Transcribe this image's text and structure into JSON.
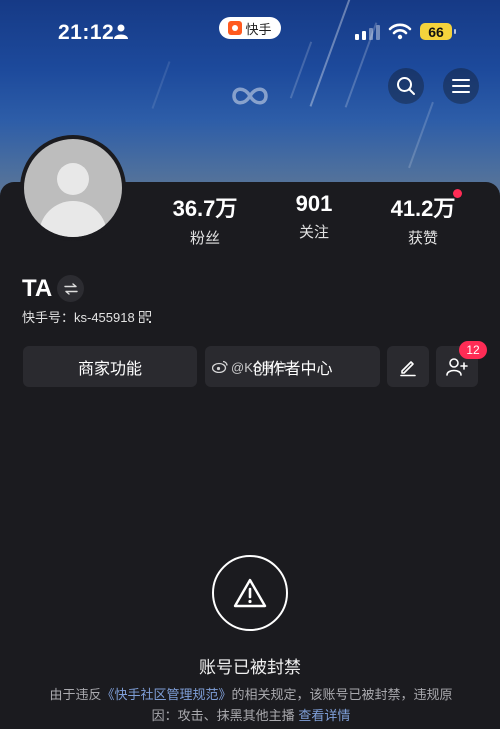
{
  "status_bar": {
    "time": "21:12",
    "app_name": "快手",
    "battery": "66"
  },
  "profile": {
    "stats": [
      {
        "value": "36.7万",
        "label": "粉丝"
      },
      {
        "value": "901",
        "label": "关注"
      },
      {
        "value": "41.2万",
        "label": "获赞"
      }
    ],
    "name": "TA",
    "account_label": "快手号：ks-455918"
  },
  "actions": {
    "merchant": "商家功能",
    "creator": "创作者中心",
    "friend_badge": "12"
  },
  "watermark": {
    "text": "@KS用户"
  },
  "banned": {
    "title": "账号已被封禁",
    "desc_prefix": "由于违反",
    "desc_rule": "《快手社区管理规范》",
    "desc_suffix": "的相关规定，该账号已被封禁，违规原因：攻击、抹黑其他主播",
    "details_link": "查看详情"
  },
  "colors": {
    "background": "#1b1b1f",
    "button": "#2a2a2f",
    "accent_red": "#fe2c55",
    "link": "#7f9fd8",
    "banner_top": "#163a86",
    "battery": "#f5d33c"
  },
  "icons": [
    "person-icon",
    "kuaishou-logo-icon",
    "cellular-signal-icon",
    "wifi-icon",
    "battery-icon",
    "infinity-icon",
    "search-icon",
    "menu-icon",
    "swap-icon",
    "qr-code-icon",
    "edit-icon",
    "add-friend-icon",
    "warning-icon",
    "weibo-icon"
  ]
}
